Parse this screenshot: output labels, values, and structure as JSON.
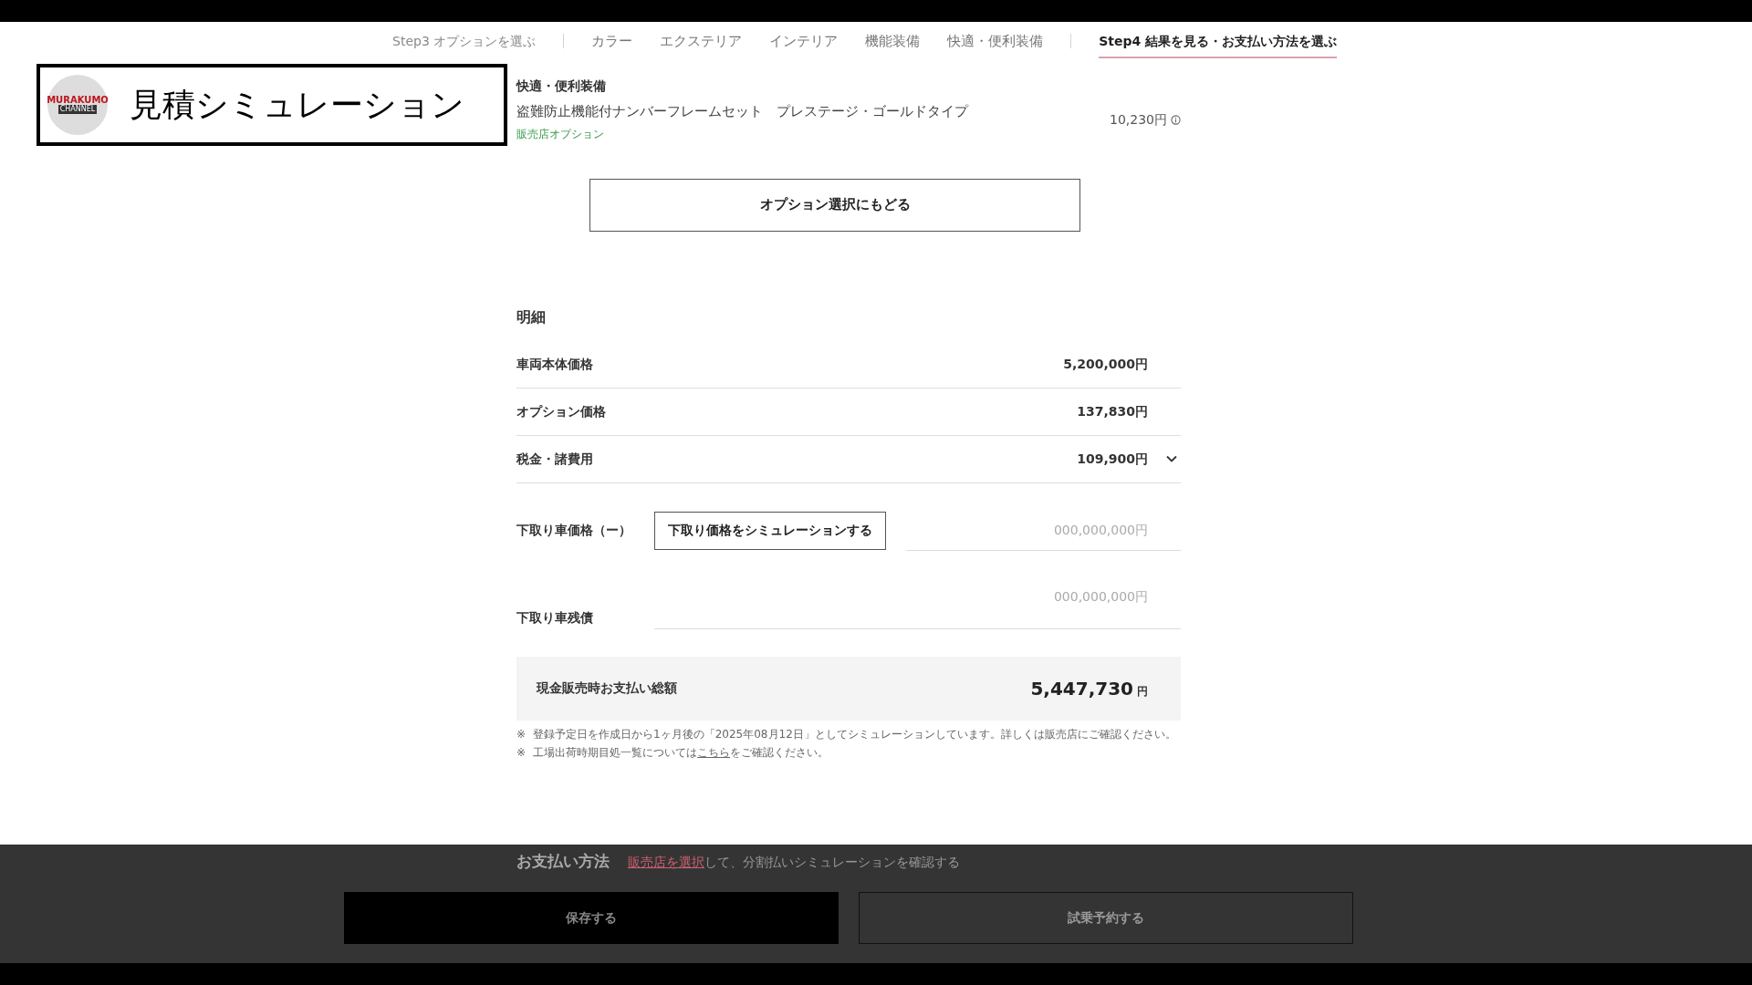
{
  "channel_badge": {
    "logo_text": "MURAKUMO",
    "logo_sub": "CHANNEL",
    "title": "見積シミュレーション"
  },
  "steps": [
    {
      "label": "Step3 オプションを選ぶ",
      "selected": false,
      "kind": "step"
    },
    {
      "label": "カラー",
      "selected": false,
      "kind": "sub"
    },
    {
      "label": "エクステリア",
      "selected": false,
      "kind": "sub"
    },
    {
      "label": "インテリア",
      "selected": false,
      "kind": "sub"
    },
    {
      "label": "機能装備",
      "selected": false,
      "kind": "sub"
    },
    {
      "label": "快適・便利装備",
      "selected": false,
      "kind": "sub"
    },
    {
      "label": "Step4 結果を見る・お支払い方法を選ぶ",
      "selected": true,
      "kind": "step"
    }
  ],
  "option_section": {
    "heading": "快適・便利装備",
    "item": "盗難防止機能付ナンバーフレームセット　プレステージ・ゴールドタイプ",
    "tag": "販売店オプション",
    "price": "10,230円"
  },
  "back_button": "オプション選択にもどる",
  "details": {
    "heading": "明細",
    "rows": [
      {
        "label": "車両本体価格",
        "value": "5,200,000円",
        "expandable": false
      },
      {
        "label": "オプション価格",
        "value": "137,830円",
        "expandable": false
      },
      {
        "label": "税金・諸費用",
        "value": "109,900円",
        "expandable": true
      }
    ],
    "trade_in": {
      "label": "下取り車価格（ー）",
      "button": "下取り価格をシミュレーションする",
      "placeholder": "000,000,000円"
    },
    "residual": {
      "label": "下取り車残債",
      "placeholder": "000,000,000円"
    },
    "total": {
      "label": "現金販売時お支払い総額",
      "value": "5,447,730",
      "unit": "円"
    },
    "notes": [
      {
        "mark": "※",
        "text": "登録予定日を作成日から1ヶ月後の「2025年08月12日」としてシミュレーションしています。詳しくは販売店にご確認ください。"
      },
      {
        "mark": "※",
        "text": "工場出荷時期目処一覧については",
        "link": "こちら",
        "after": "をご確認ください。"
      }
    ]
  },
  "payment": {
    "heading": "お支払い方法",
    "link": "販売店を選択",
    "text": "して、分割払いシミュレーションを確認する"
  },
  "actions": [
    {
      "label": "保存する",
      "kind": "primary"
    },
    {
      "label": "試乗予約する",
      "kind": "secondary"
    }
  ]
}
